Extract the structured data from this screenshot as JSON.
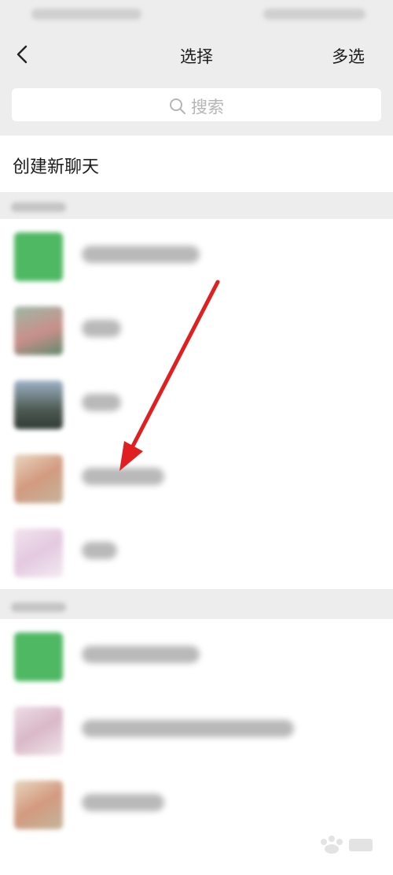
{
  "nav": {
    "title": "选择",
    "multi_select": "多选"
  },
  "search": {
    "placeholder": "搜索"
  },
  "new_chat": {
    "label": "创建新聊天"
  },
  "colors": {
    "green_avatar": "#4fb863",
    "arrow": "#e02020"
  }
}
